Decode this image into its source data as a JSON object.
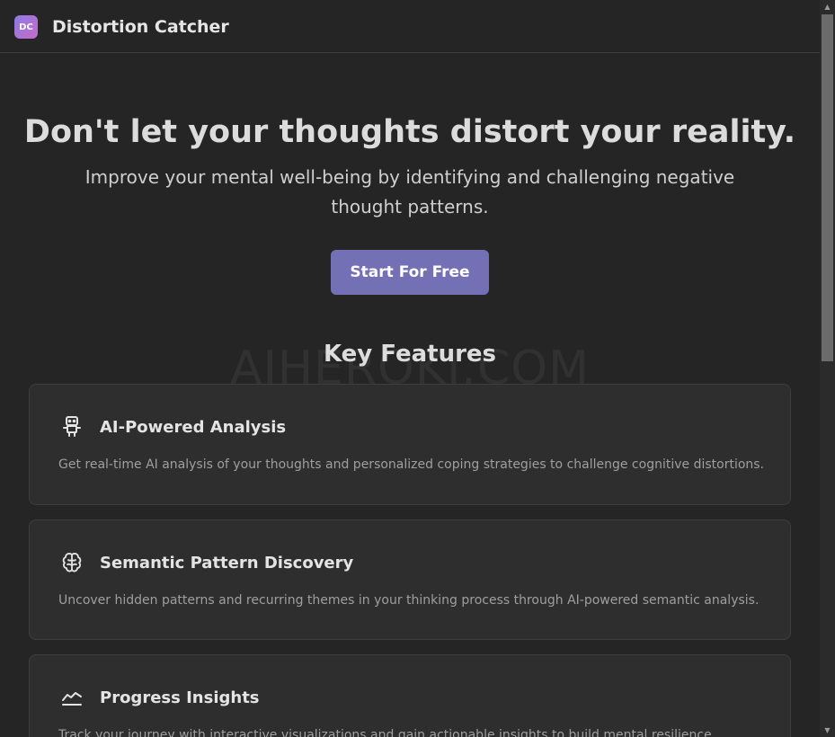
{
  "header": {
    "logo_text": "DC",
    "app_name": "Distortion Catcher"
  },
  "hero": {
    "title": "Don't let your thoughts distort your reality.",
    "subtitle": "Improve your mental well-being by identifying and challenging negative thought patterns.",
    "cta_label": "Start For Free"
  },
  "features": {
    "heading": "Key Features",
    "watermark": "AIHEROKI.COM",
    "items": [
      {
        "icon": "robot-icon",
        "title": "AI-Powered Analysis",
        "description": "Get real-time AI analysis of your thoughts and personalized coping strategies to challenge cognitive distortions."
      },
      {
        "icon": "brain-icon",
        "title": "Semantic Pattern Discovery",
        "description": "Uncover hidden patterns and recurring themes in your thinking process through AI-powered semantic analysis."
      },
      {
        "icon": "chart-line-icon",
        "title": "Progress Insights",
        "description": "Track your journey with interactive visualizations and gain actionable insights to build mental resilience."
      }
    ]
  },
  "colors": {
    "background": "#252525",
    "card": "#2e2e2e",
    "accent": "#7470b5",
    "logo_gradient_start": "#8e7ae6",
    "logo_gradient_end": "#c46cc7"
  }
}
